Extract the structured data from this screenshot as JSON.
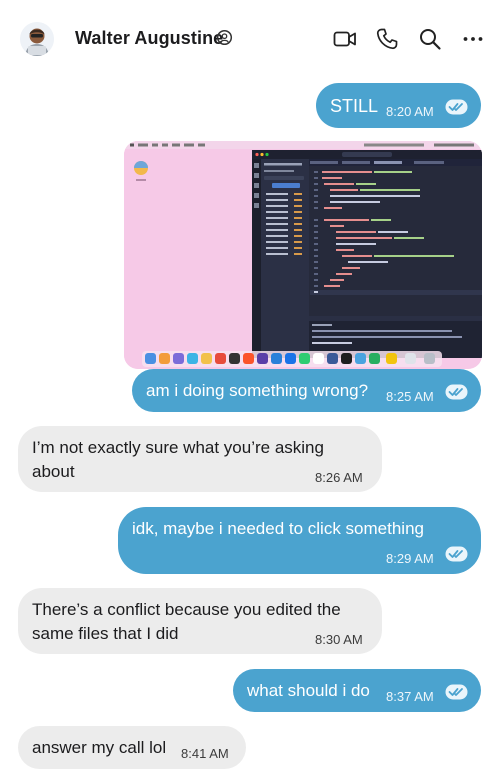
{
  "header": {
    "contact_name": "Walter Augustine",
    "icons": [
      "avatar",
      "verified-badge-icon",
      "video-call-icon",
      "phone-call-icon",
      "search-icon",
      "more-options-icon"
    ]
  },
  "messages": [
    {
      "direction": "outgoing",
      "text": "STILL",
      "time": "8:20 AM",
      "status": "read"
    },
    {
      "direction": "outgoing",
      "type": "image",
      "description": "",
      "time": "",
      "status": "read"
    },
    {
      "direction": "outgoing",
      "text": "am i doing something wrong?",
      "time": "8:25 AM",
      "status": "read"
    },
    {
      "direction": "incoming",
      "text_line1": "I’m not exactly sure what you’re asking",
      "text_line2": "about",
      "time": "8:26 AM"
    },
    {
      "direction": "outgoing",
      "text": "idk, maybe i needed to click something",
      "time": "8:29 AM",
      "status": "read"
    },
    {
      "direction": "incoming",
      "text_line1": "There’s a conflict because you edited the",
      "text_line2": "same files that I did",
      "time": "8:30 AM"
    },
    {
      "direction": "outgoing",
      "text": "what should i do",
      "time": "8:37 AM",
      "status": "read"
    },
    {
      "direction": "incoming",
      "text": "answer my call lol",
      "time": "8:41 AM"
    }
  ],
  "colors": {
    "outgoing_bubble": "#4ba3cf",
    "incoming_bubble": "#ececec",
    "attachment_background": "#f6c9e7",
    "editor_background": "#262a3b"
  }
}
